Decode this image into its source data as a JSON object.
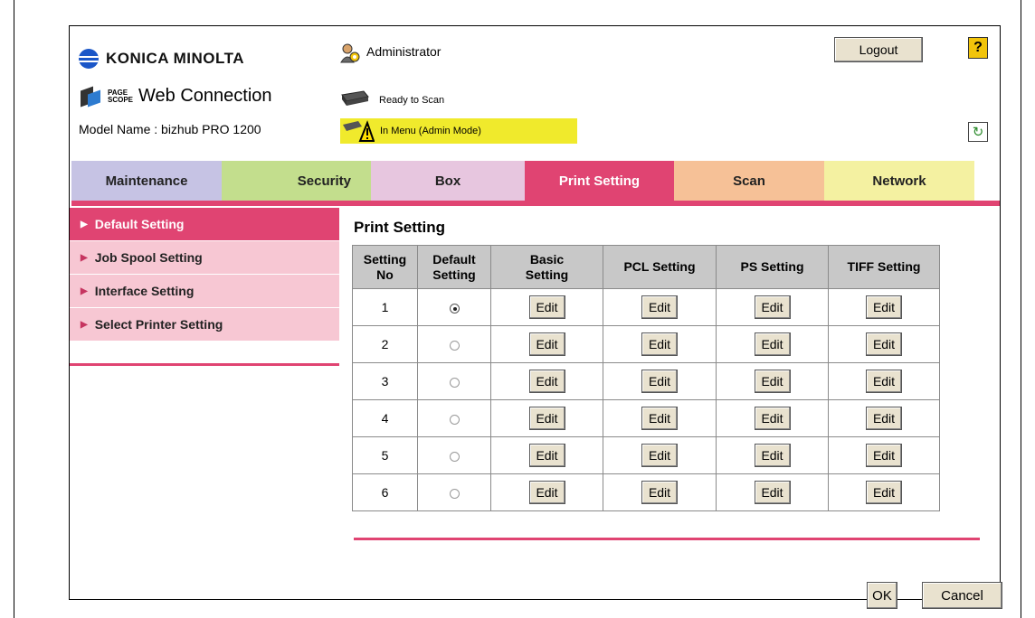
{
  "header": {
    "brand": "KONICA MINOLTA",
    "product_small_top": "PAGE",
    "product_small_bottom": "SCOPE",
    "product": "Web Connection",
    "model": "Model Name : bizhub PRO 1200",
    "user": "Administrator",
    "logout_label": "Logout",
    "help_label": "?",
    "status_ready": "Ready to Scan",
    "status_menu": "In Menu (Admin Mode)",
    "refresh_icon": "refresh-icon",
    "colors": {
      "accent": "#e04472",
      "warning": "#f0ea2c",
      "button": "#e9e2cf"
    }
  },
  "tabs": [
    {
      "label": "Maintenance",
      "color": "#c6c3e4"
    },
    {
      "label": "Security",
      "color": "#c3de8d"
    },
    {
      "label": "Box",
      "color": "#e7c6df"
    },
    {
      "label": "Print Setting",
      "color": "#e04472",
      "active": true
    },
    {
      "label": "Scan",
      "color": "#f6c197"
    },
    {
      "label": "Network",
      "color": "#f4f1a1"
    }
  ],
  "sidebar": {
    "items": [
      {
        "label": "Default Setting",
        "active": true
      },
      {
        "label": "Job Spool Setting"
      },
      {
        "label": "Interface Setting"
      },
      {
        "label": "Select Printer Setting"
      }
    ]
  },
  "main": {
    "title": "Print Setting",
    "columns": {
      "setting_no_1": "Setting",
      "setting_no_2": "No",
      "default_1": "Default",
      "default_2": "Setting",
      "basic_1": "Basic",
      "basic_2": "Setting",
      "pcl": "PCL Setting",
      "ps": "PS Setting",
      "tiff": "TIFF Setting"
    },
    "edit_label": "Edit",
    "rows": [
      {
        "no": "1",
        "default": true
      },
      {
        "no": "2",
        "default": false
      },
      {
        "no": "3",
        "default": false
      },
      {
        "no": "4",
        "default": false
      },
      {
        "no": "5",
        "default": false
      },
      {
        "no": "6",
        "default": false
      }
    ],
    "ok_label": "OK",
    "cancel_label": "Cancel"
  }
}
